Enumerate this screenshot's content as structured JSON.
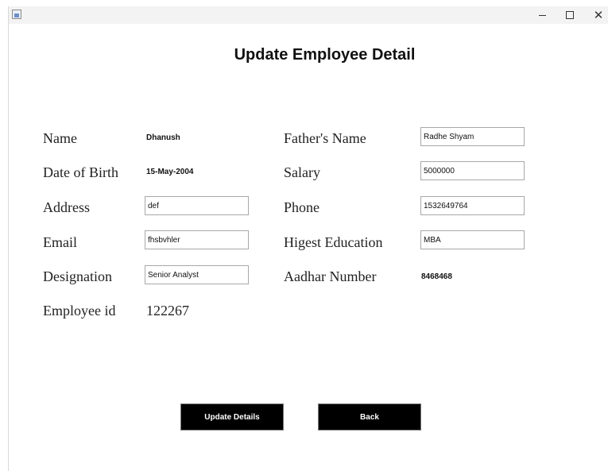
{
  "window": {
    "controls": {
      "minimize_icon": "minimize-icon",
      "maximize_icon": "maximize-icon",
      "close_icon": "close-icon",
      "close_glyph": "✕"
    }
  },
  "page": {
    "title": "Update Employee Detail"
  },
  "form": {
    "name": {
      "label": "Name",
      "value": "Dhanush"
    },
    "dob": {
      "label": "Date of Birth",
      "value": "15-May-2004"
    },
    "address": {
      "label": "Address",
      "value": "def"
    },
    "email": {
      "label": "Email",
      "value": "fhsbvhler"
    },
    "designation": {
      "label": "Designation",
      "value": "Senior Analyst"
    },
    "employee_id": {
      "label": "Employee id",
      "value": "122267"
    },
    "father_name": {
      "label": "Father's Name",
      "value": "Radhe Shyam"
    },
    "salary": {
      "label": "Salary",
      "value": "5000000"
    },
    "phone": {
      "label": "Phone",
      "value": "1532649764"
    },
    "education": {
      "label": "Higest Education",
      "value": "MBA"
    },
    "aadhar": {
      "label": "Aadhar Number",
      "value": "8468468"
    }
  },
  "actions": {
    "update_label": "Update Details",
    "back_label": "Back"
  },
  "colors": {
    "button_bg": "#000000",
    "button_text": "#ffffff",
    "field_border": "#a8a8a8"
  }
}
